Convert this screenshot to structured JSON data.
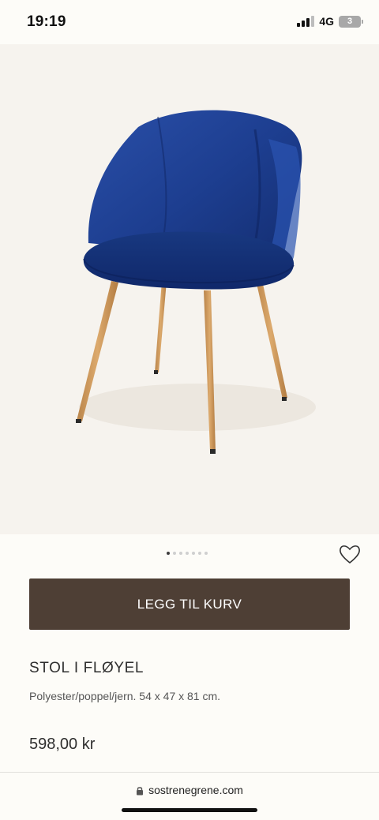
{
  "status_bar": {
    "time": "19:19",
    "network": "4G",
    "battery": "3"
  },
  "product": {
    "image_icon": "blue-velvet-chair-photo",
    "carousel": {
      "count": 7,
      "active_index": 0
    },
    "add_to_cart_label": "LEGG TIL KURV",
    "title": "STOL I FLØYEL",
    "description": "Polyester/poppel/jern. 54 x 47 x 81 cm.",
    "price": "598,00 kr"
  },
  "browser": {
    "url": "sostrenegrene.com"
  },
  "colors": {
    "accent_button": "#4e3f35",
    "chair_velvet": "#1c3d8f",
    "chair_legs": "#cf9a5c",
    "background": "#fdfcf8"
  }
}
